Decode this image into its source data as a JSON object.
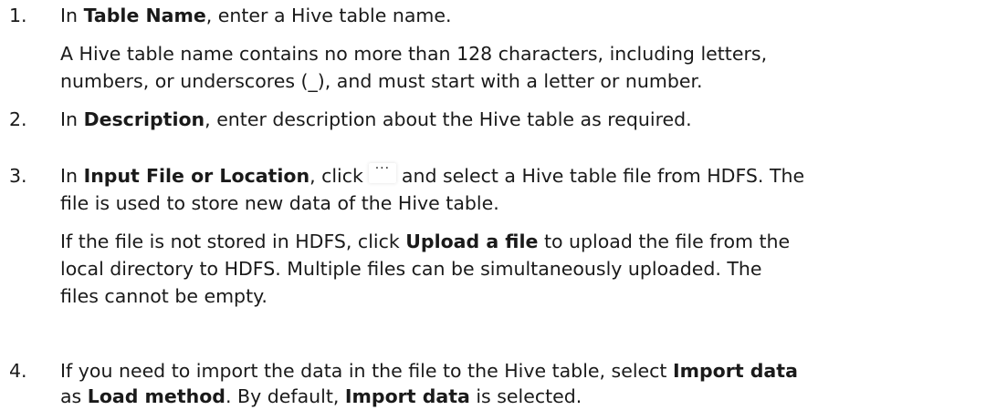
{
  "steps": [
    {
      "num": "1.",
      "prefix": "In ",
      "bold": "Table Name",
      "rest": ", enter a Hive table name.",
      "note_line1": "A Hive table name contains no more than 128 characters, including letters,",
      "note_line2": "numbers, or underscores (_), and must start with a letter or number."
    },
    {
      "num": "2.",
      "prefix": "In ",
      "bold": "Description",
      "rest": ", enter description about the Hive table as required."
    },
    {
      "num": "3.",
      "prefix": "In ",
      "bold": "Input File or Location",
      "mid": ", click",
      "button_glyph": "···",
      "after_button": "and select a Hive table file from HDFS. The",
      "line2": "file is used to store new data of the Hive table.",
      "note_line1_prefix": "If the file is not stored in HDFS, click ",
      "note_line1_bold": "Upload a file",
      "note_line1_rest": " to upload the file from the",
      "note_line2": "local directory to HDFS. Multiple files can be simultaneously uploaded. The",
      "note_line3": "files cannot be empty."
    },
    {
      "num": "4.",
      "line1_prefix": "If you need to import the data in the file to the Hive table, select ",
      "line1_bold": "Import data",
      "line2_prefix": "as ",
      "line2_bold1": "Load method",
      "line2_mid": ". By default, ",
      "line2_bold2": "Import data",
      "line2_rest": " is selected."
    }
  ]
}
